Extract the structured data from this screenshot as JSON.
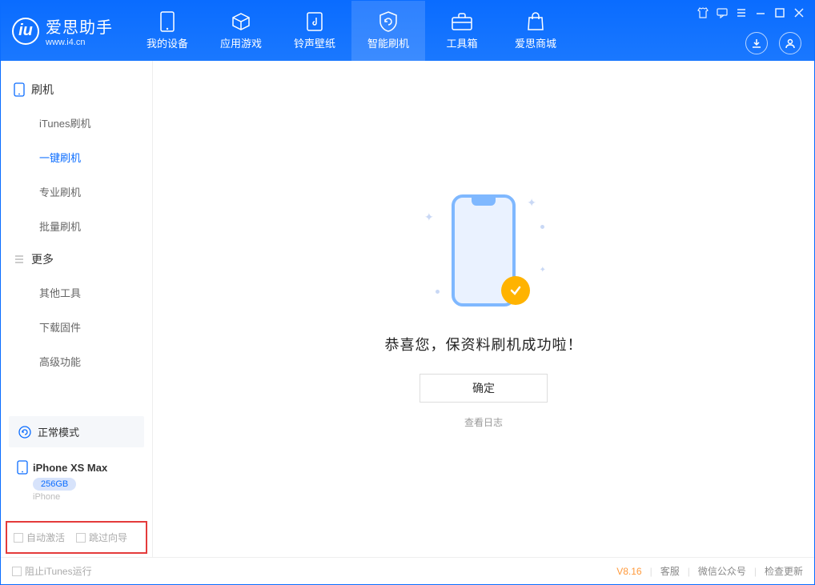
{
  "brand": {
    "name": "爱思助手",
    "url": "www.i4.cn"
  },
  "top_tabs": {
    "my_device": "我的设备",
    "apps_games": "应用游戏",
    "ring_wall": "铃声壁纸",
    "smart_flash": "智能刷机",
    "toolbox": "工具箱",
    "store": "爱思商城"
  },
  "sidebar": {
    "group1_title": "刷机",
    "g1_items": {
      "itunes": "iTunes刷机",
      "one_click": "一键刷机",
      "pro": "专业刷机",
      "batch": "批量刷机"
    },
    "group2_title": "更多",
    "g2_items": {
      "other_tools": "其他工具",
      "download_fw": "下载固件",
      "advanced": "高级功能"
    },
    "status_label": "正常模式",
    "device": {
      "name": "iPhone XS Max",
      "capacity": "256GB",
      "type": "iPhone"
    },
    "checks": {
      "auto_activate": "自动激活",
      "skip_guide": "跳过向导"
    }
  },
  "main": {
    "success_msg": "恭喜您，保资料刷机成功啦！",
    "ok_btn": "确定",
    "view_log": "查看日志"
  },
  "footer": {
    "block_itunes": "阻止iTunes运行",
    "version": "V8.16",
    "support": "客服",
    "wechat": "微信公众号",
    "check_update": "检查更新"
  }
}
